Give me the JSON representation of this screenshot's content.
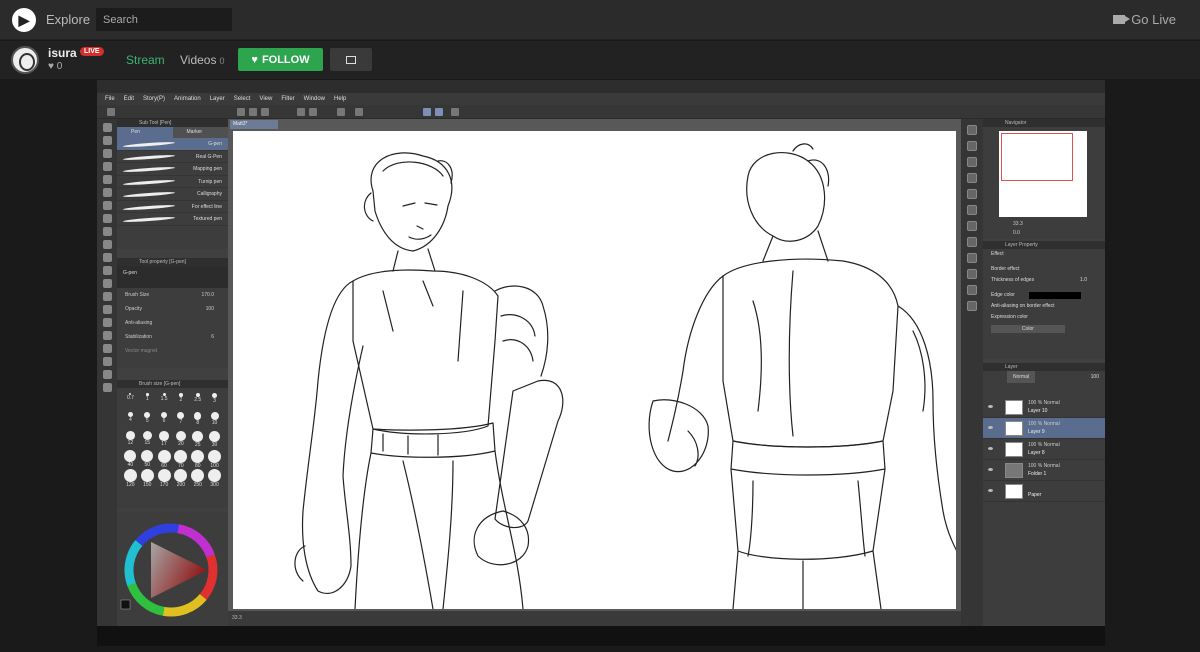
{
  "topbar": {
    "explore": "Explore",
    "search_placeholder": "Search",
    "go_live": "Go Live"
  },
  "channel": {
    "username": "isura",
    "live_badge": "LIVE",
    "heart_count": "0",
    "tab_stream": "Stream",
    "tab_videos": "Videos",
    "videos_count": "0",
    "follow_label": "FOLLOW"
  },
  "app": {
    "menu": [
      "File",
      "Edit",
      "Story(P)",
      "Animation",
      "Layer",
      "Select",
      "View",
      "Filter",
      "Window",
      "Help"
    ],
    "sub_tool_panel": "Sub Tool [Pen]",
    "sub_tabs": [
      "Pen",
      "Marker"
    ],
    "pens": [
      "G-pen",
      "Real G-Pen",
      "Mapping pen",
      "Turnip pen",
      "Calligraphy",
      "For effect line",
      "Textured pen"
    ],
    "tool_property_title": "Tool property [G-pen]",
    "tool_property_tag": "G-pen",
    "brush_size_label": "Brush Size",
    "brush_size_value": "170.0",
    "opacity_label": "Opacity",
    "opacity_value": "100",
    "anti_aliasing_label": "Anti-aliasing",
    "stabilization_label": "Stabilization",
    "stabilization_value": "6",
    "vector_magnet_label": "Vector magnet",
    "brush_size_panel": "Brush size [G-pen]",
    "brush_sizes": [
      "0.7",
      "1",
      "1.5",
      "2",
      "2.5",
      "3",
      "4",
      "5",
      "6",
      "7",
      "8",
      "10",
      "12",
      "15",
      "17",
      "20",
      "25",
      "30",
      "40",
      "50",
      "60",
      "70",
      "80",
      "100",
      "120",
      "150",
      "170",
      "200",
      "250",
      "300"
    ],
    "canvas_zoom": "33.3",
    "navigator_title": "Navigator",
    "navigator_zoom": "33.3",
    "navigator_angle": "0.0",
    "layer_property_title": "Layer Property",
    "effect_label": "Effect",
    "border_effect_label": "Border effect",
    "thickness_label": "Thickness of edges",
    "thickness_value": "1.0",
    "edge_color_label": "Edge color",
    "anti_aliasing_border": "Anti-aliasing on border effect",
    "expression_color_label": "Expression color",
    "expression_color_value": "Color",
    "layer_panel_title": "Layer",
    "blend_mode": "Normal",
    "blend_opacity": "100",
    "layers": [
      {
        "mode": "100 % Normal",
        "name": "Layer 10"
      },
      {
        "mode": "100 % Normal",
        "name": "Layer 9"
      },
      {
        "mode": "100 % Normal",
        "name": "Layer 8"
      },
      {
        "mode": "100 % Normal",
        "name": "Folder 1"
      },
      {
        "mode": "",
        "name": "Paper"
      }
    ]
  },
  "colors": {
    "follow_green": "#2da44e",
    "stream_green": "#3cb371",
    "live_red": "#d32f2f",
    "selection_blue": "#5b6d8f"
  }
}
